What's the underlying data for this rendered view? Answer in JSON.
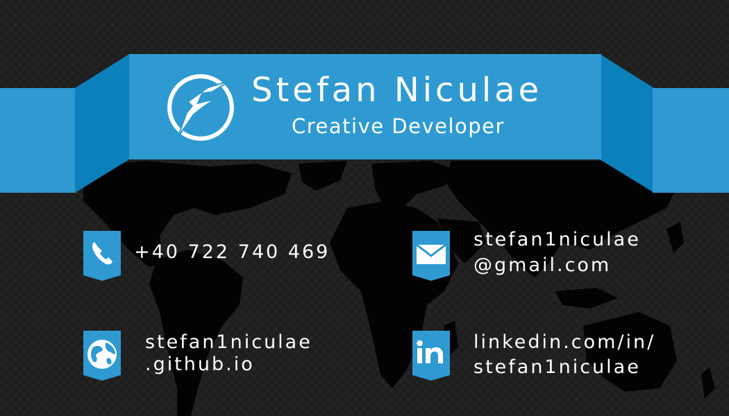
{
  "header": {
    "name": "Stefan Niculae",
    "title": "Creative Developer",
    "logo_icon": "lightning-f-logo-icon"
  },
  "contacts": {
    "phone": {
      "icon": "phone-icon",
      "value": "+40 722 740 469"
    },
    "email": {
      "icon": "envelope-icon",
      "line1": "stefan1niculae",
      "line2": "@gmail.com"
    },
    "website": {
      "icon": "globe-icon",
      "line1": "stefan1niculae",
      "line2": ".github.io"
    },
    "linkedin": {
      "icon": "linkedin-icon",
      "line1": "linkedin.com/in/",
      "line2": "stefan1niculae"
    }
  },
  "colors": {
    "background": "#1e1e1e",
    "map": "#030303",
    "ribbon_front": "#2f9ad2",
    "ribbon_fold": "#0b80bb",
    "text": "#ffffff"
  }
}
